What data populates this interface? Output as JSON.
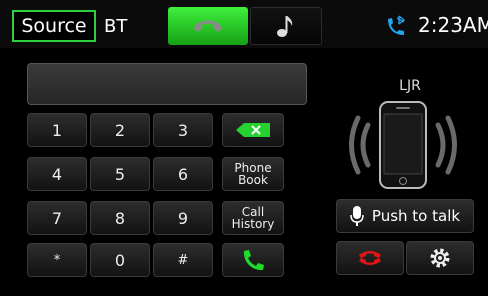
{
  "header": {
    "source_label": "Source",
    "source_value": "BT",
    "clock": "2:23AM"
  },
  "tabs": [
    {
      "name": "phone",
      "icon": "handset-icon",
      "active": true
    },
    {
      "name": "music",
      "icon": "music-note-icon",
      "active": false
    }
  ],
  "dialer": {
    "display_value": "",
    "keys": [
      "1",
      "2",
      "3",
      "4",
      "5",
      "6",
      "7",
      "8",
      "9",
      "*",
      "0",
      "#"
    ],
    "phonebook_label": [
      "Phone",
      "Book"
    ],
    "callhistory_label": [
      "Call",
      "History"
    ]
  },
  "device": {
    "name": "LJR"
  },
  "push_to_talk": {
    "label": "Push to talk"
  },
  "colors": {
    "accent": "#2ecf3a",
    "call_green": "#1fdc2a",
    "hangup_red": "#e01414"
  }
}
